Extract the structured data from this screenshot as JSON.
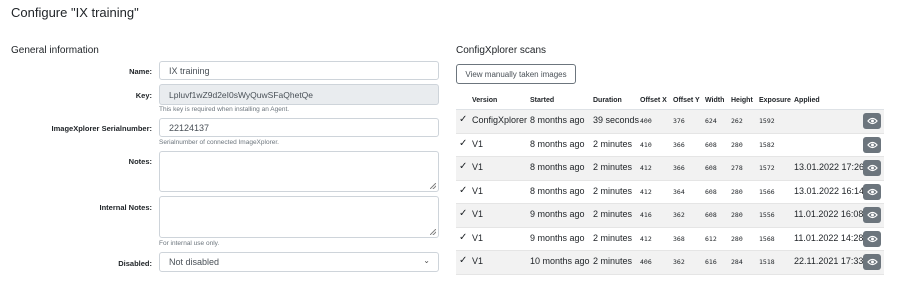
{
  "page": {
    "title": "Configure \"IX training\""
  },
  "general": {
    "heading": "General information",
    "name": {
      "label": "Name:",
      "value": "IX training"
    },
    "key": {
      "label": "Key:",
      "value": "Lpluvf1wZ9d2eI0sWyQuwSFaQhetQe",
      "help": "This key is required when installing an Agent."
    },
    "serial": {
      "label": "ImageXplorer Serialnumber:",
      "value": "22124137",
      "help": "Serialnumber of connected ImageXplorer."
    },
    "notes": {
      "label": "Notes:",
      "value": ""
    },
    "internal_notes": {
      "label": "Internal Notes:",
      "value": "",
      "help": "For internal use only."
    },
    "disabled": {
      "label": "Disabled:",
      "value": "Not disabled"
    }
  },
  "scans": {
    "heading": "ConfigXplorer scans",
    "view_button": "View manually taken images",
    "columns": {
      "version": "Version",
      "started": "Started",
      "duration": "Duration",
      "offset_x": "Offset X",
      "offset_y": "Offset Y",
      "width": "Width",
      "height": "Height",
      "exposure": "Exposure",
      "applied": "Applied"
    },
    "rows": [
      {
        "version": "ConfigXplorer",
        "started": "8 months ago",
        "duration": "39 seconds",
        "offset_x": "400",
        "offset_y": "376",
        "width": "624",
        "height": "262",
        "exposure": "1592",
        "applied": ""
      },
      {
        "version": "V1",
        "started": "8 months ago",
        "duration": "2 minutes",
        "offset_x": "410",
        "offset_y": "366",
        "width": "608",
        "height": "280",
        "exposure": "1582",
        "applied": ""
      },
      {
        "version": "V1",
        "started": "8 months ago",
        "duration": "2 minutes",
        "offset_x": "412",
        "offset_y": "366",
        "width": "608",
        "height": "278",
        "exposure": "1572",
        "applied": "13.01.2022 17:26"
      },
      {
        "version": "V1",
        "started": "8 months ago",
        "duration": "2 minutes",
        "offset_x": "412",
        "offset_y": "364",
        "width": "608",
        "height": "280",
        "exposure": "1566",
        "applied": "13.01.2022 16:14"
      },
      {
        "version": "V1",
        "started": "9 months ago",
        "duration": "2 minutes",
        "offset_x": "416",
        "offset_y": "362",
        "width": "608",
        "height": "280",
        "exposure": "1556",
        "applied": "11.01.2022 16:08"
      },
      {
        "version": "V1",
        "started": "9 months ago",
        "duration": "2 minutes",
        "offset_x": "412",
        "offset_y": "368",
        "width": "612",
        "height": "280",
        "exposure": "1568",
        "applied": "11.01.2022 14:28"
      },
      {
        "version": "V1",
        "started": "10 months ago",
        "duration": "2 minutes",
        "offset_x": "406",
        "offset_y": "362",
        "width": "616",
        "height": "284",
        "exposure": "1518",
        "applied": "22.11.2021 17:33"
      }
    ],
    "row_icons": {
      "status": "check-icon",
      "action": "eye-icon"
    }
  }
}
